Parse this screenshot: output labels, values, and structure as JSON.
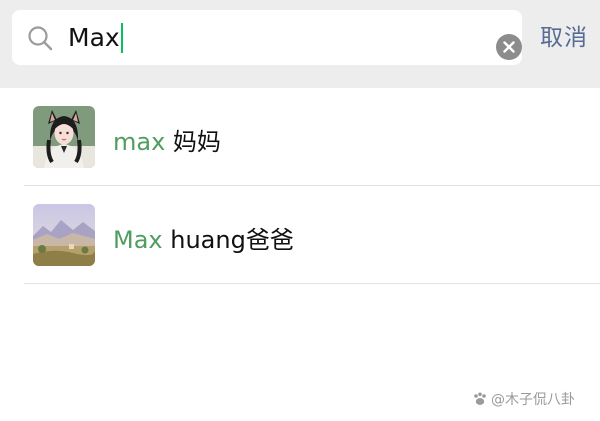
{
  "search": {
    "query": "Max",
    "cancel_label": "取消"
  },
  "results": [
    {
      "highlight": "max",
      "rest": " 妈妈",
      "avatar": "portrait-avatar"
    },
    {
      "highlight": "Max",
      "rest": " huang爸爸",
      "avatar": "landscape-avatar"
    }
  ],
  "watermark": {
    "text": "@木子侃八卦",
    "icon": "paw-icon"
  },
  "colors": {
    "highlight": "#4f9d5f",
    "cancel": "#576b95",
    "caret": "#07c160",
    "bar_background": "#ededed"
  }
}
